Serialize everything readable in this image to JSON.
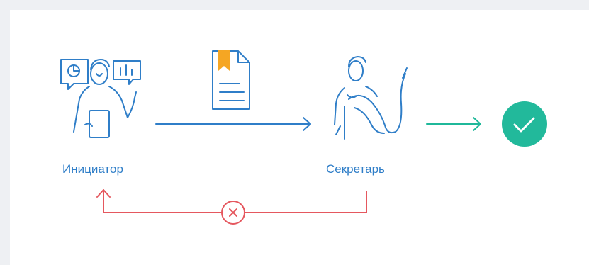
{
  "nodes": {
    "initiator": {
      "label": "Инициатор"
    },
    "secretary": {
      "label": "Секретарь"
    }
  },
  "colors": {
    "primary": "#2f7ec8",
    "approve": "#1fb89a",
    "approve_fill": "#22b99b",
    "reject": "#e5585f",
    "bookmark": "#f5a623",
    "background": "#eef0f3",
    "card": "#ffffff"
  },
  "icons": {
    "initiator": "presenter-with-charts-icon",
    "document": "document-with-bookmark-icon",
    "secretary": "secretary-with-document-icon",
    "done": "check-circle-icon",
    "reject": "reject-x-icon"
  }
}
